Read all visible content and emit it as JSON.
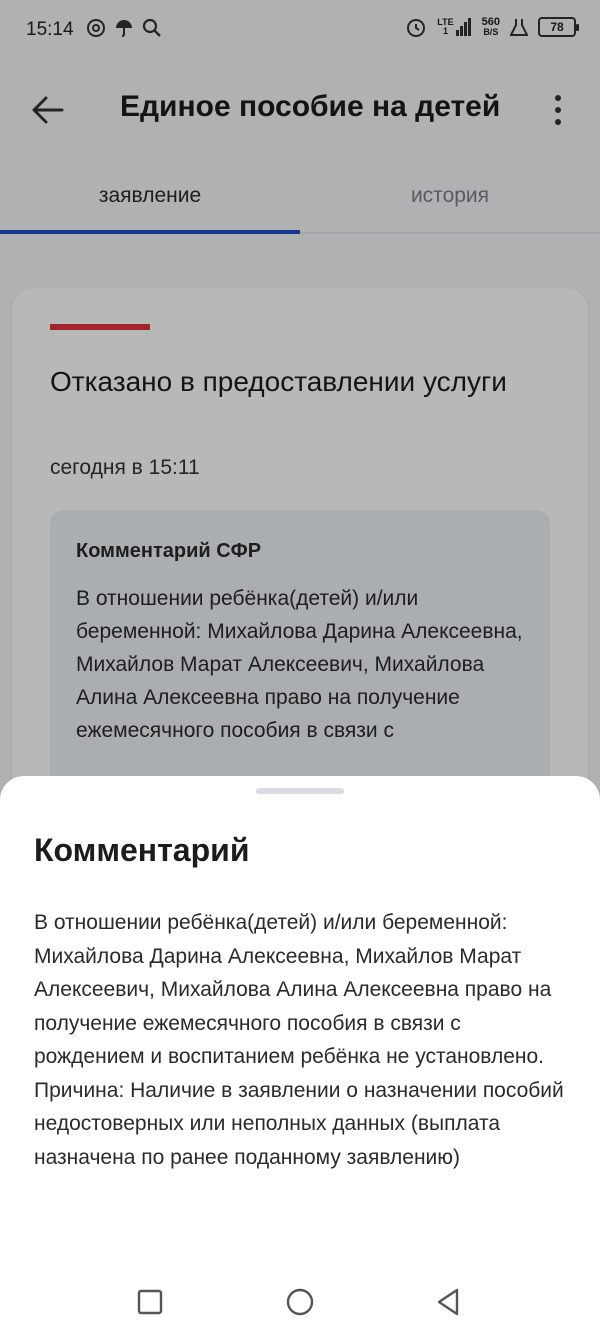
{
  "status_bar": {
    "time": "15:14",
    "left_icons": [
      "at-icon",
      "umbrella-icon",
      "search-icon"
    ],
    "network_label": "LTE",
    "network_sub": "1",
    "speed_value": "560",
    "speed_unit": "B/S",
    "battery_level": "78"
  },
  "app_bar": {
    "title": "Единое пособие на детей",
    "back_icon": "arrow-left-icon",
    "menu_icon": "more-vertical-icon"
  },
  "tabs": [
    {
      "label": "заявление",
      "active": true
    },
    {
      "label": "история",
      "active": false
    }
  ],
  "status_card": {
    "title": "Отказано в предоставлении услуги",
    "time": "сегодня в 15:11",
    "accent_color": "#e0343f",
    "comment_title": "Комментарий СФР",
    "comment_preview": "В отношении ребёнка(детей) и/или беременной: Михайлова Дарина Алексеевна, Михайлов Марат Алексеевич, Михайлова Алина Алексеевна право на получение ежемесячного пособия в связи с"
  },
  "bottom_sheet": {
    "title": "Комментарий",
    "text": "В отношении ребёнка(детей) и/или беременной: Михайлова Дарина Алексеевна, Михайлов Марат Алексеевич, Михайлова Алина Алексеевна право на получение ежемесячного пособия в связи с рождением и воспитанием ребёнка не установлено. Причина: Наличие в заявлении о назначении пособий недостоверных или неполных данных (выплата назначена по ранее поданному заявлению)"
  },
  "nav_bar": {
    "icons": [
      "recents-square-icon",
      "home-circle-icon",
      "back-triangle-icon"
    ]
  },
  "colors": {
    "tab_indicator": "#1c4fbf",
    "background": "#f4f6f9",
    "comment_box": "#eef1f5"
  }
}
